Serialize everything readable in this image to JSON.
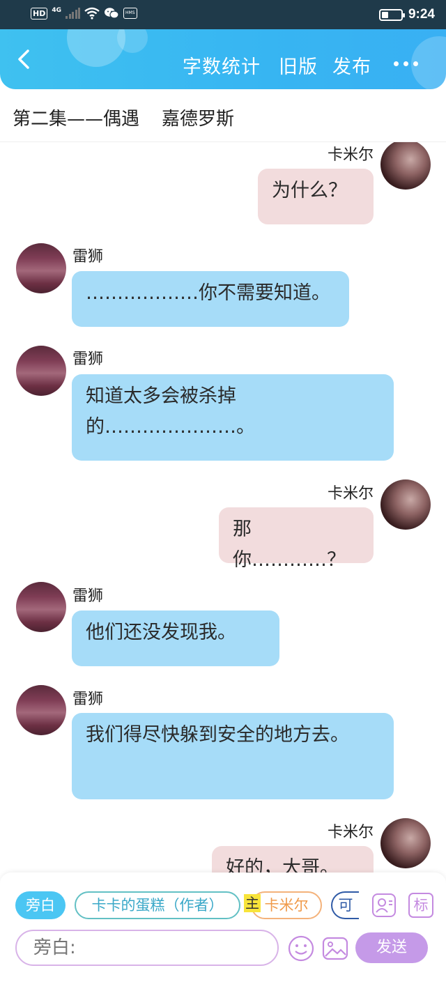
{
  "status_bar": {
    "hd": "HD",
    "network": "4G",
    "hms": "HMS",
    "time": "9:24",
    "icons": [
      "signal-icon",
      "wifi-icon",
      "wechat-icon",
      "battery-icon"
    ]
  },
  "header": {
    "back_icon": "chevron-left-icon",
    "actions": [
      "字数统计",
      "旧版",
      "发布"
    ],
    "more_icon": "more-dots-icon",
    "accent_color": "#3fb9f2"
  },
  "title_row": {
    "episode": "第二集——偶遇",
    "character": "嘉德罗斯"
  },
  "messages": [
    {
      "side": "right",
      "name": "卡米尔",
      "text": "为什么？"
    },
    {
      "side": "left",
      "name": "雷狮",
      "text": "………………你不需要知道。"
    },
    {
      "side": "left",
      "name": "雷狮",
      "text": "知道太多会被杀掉的…………………。"
    },
    {
      "side": "right",
      "name": "卡米尔",
      "text": "那你…………？"
    },
    {
      "side": "left",
      "name": "雷狮",
      "text": "他们还没发现我。"
    },
    {
      "side": "left",
      "name": "雷狮",
      "text": "我们得尽快躲到安全的地方去。"
    },
    {
      "side": "right",
      "name": "卡米尔",
      "text": "好的，大哥。"
    }
  ],
  "composer": {
    "chips": [
      "旁白",
      "卡卡的蛋糕（作者）",
      "卡米尔",
      "可"
    ],
    "main_mark": "主",
    "icons": [
      "user-profile-icon",
      "tag-icon",
      "emoji-icon",
      "image-icon"
    ],
    "tag_label": "标",
    "input_placeholder": "旁白:",
    "send_label": "发送"
  }
}
